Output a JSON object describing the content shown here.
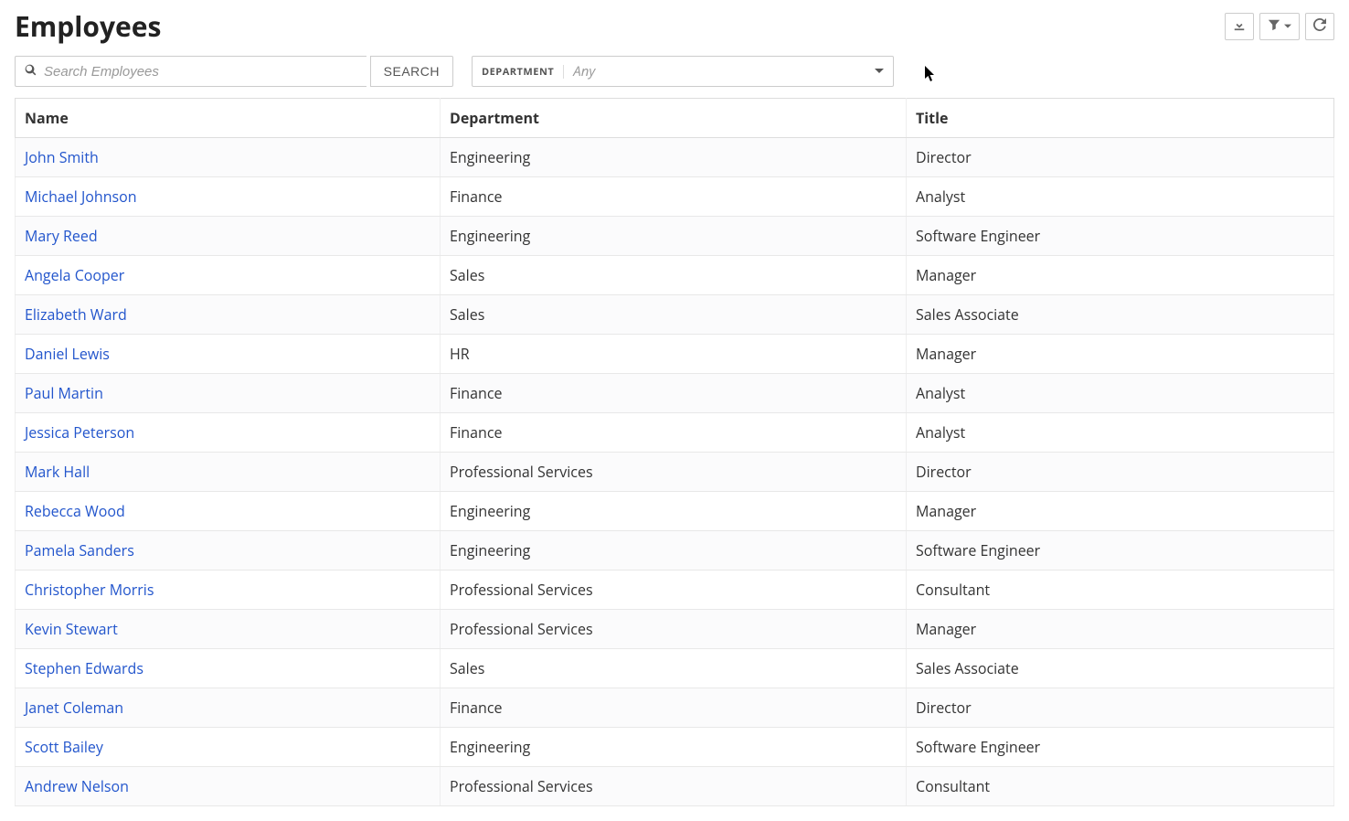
{
  "page": {
    "title": "Employees"
  },
  "search": {
    "placeholder": "Search Employees",
    "button_label": "SEARCH",
    "value": ""
  },
  "department_filter": {
    "label": "DEPARTMENT",
    "placeholder": "Any",
    "selected": ""
  },
  "toolbar": {
    "download_icon": "download",
    "filter_icon": "filter",
    "refresh_icon": "refresh"
  },
  "table": {
    "columns": [
      "Name",
      "Department",
      "Title"
    ],
    "rows": [
      {
        "name": "John Smith",
        "department": "Engineering",
        "title": "Director"
      },
      {
        "name": "Michael Johnson",
        "department": "Finance",
        "title": "Analyst"
      },
      {
        "name": "Mary Reed",
        "department": "Engineering",
        "title": "Software Engineer"
      },
      {
        "name": "Angela Cooper",
        "department": "Sales",
        "title": "Manager"
      },
      {
        "name": "Elizabeth Ward",
        "department": "Sales",
        "title": "Sales Associate"
      },
      {
        "name": "Daniel Lewis",
        "department": "HR",
        "title": "Manager"
      },
      {
        "name": "Paul Martin",
        "department": "Finance",
        "title": "Analyst"
      },
      {
        "name": "Jessica Peterson",
        "department": "Finance",
        "title": "Analyst"
      },
      {
        "name": "Mark Hall",
        "department": "Professional Services",
        "title": "Director"
      },
      {
        "name": "Rebecca Wood",
        "department": "Engineering",
        "title": "Manager"
      },
      {
        "name": "Pamela Sanders",
        "department": "Engineering",
        "title": "Software Engineer"
      },
      {
        "name": "Christopher Morris",
        "department": "Professional Services",
        "title": "Consultant"
      },
      {
        "name": "Kevin Stewart",
        "department": "Professional Services",
        "title": "Manager"
      },
      {
        "name": "Stephen Edwards",
        "department": "Sales",
        "title": "Sales Associate"
      },
      {
        "name": "Janet Coleman",
        "department": "Finance",
        "title": "Director"
      },
      {
        "name": "Scott Bailey",
        "department": "Engineering",
        "title": "Software Engineer"
      },
      {
        "name": "Andrew Nelson",
        "department": "Professional Services",
        "title": "Consultant"
      }
    ]
  }
}
